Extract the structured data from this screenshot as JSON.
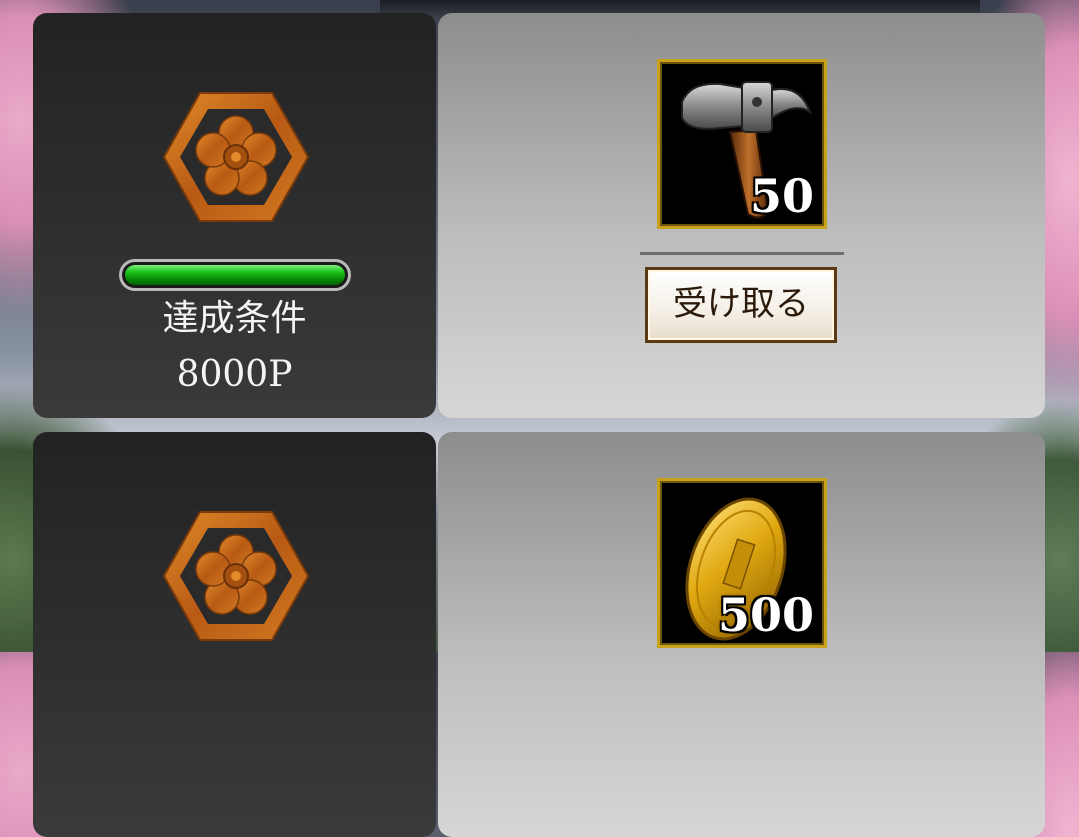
{
  "rewards": [
    {
      "progress_fraction": 1.0,
      "condition_label": "達成条件",
      "condition_value": "8000P",
      "reward_icon": "hammer-icon",
      "reward_quantity": "50",
      "receive_label": "受け取る"
    },
    {
      "reward_icon": "koban-gold-coin-icon",
      "reward_quantity": "500"
    }
  ],
  "colors": {
    "crest": "#c56a1c",
    "progress_fill": "#19c419",
    "item_frame": "#c9a21c",
    "button_border": "#5a3a12"
  }
}
